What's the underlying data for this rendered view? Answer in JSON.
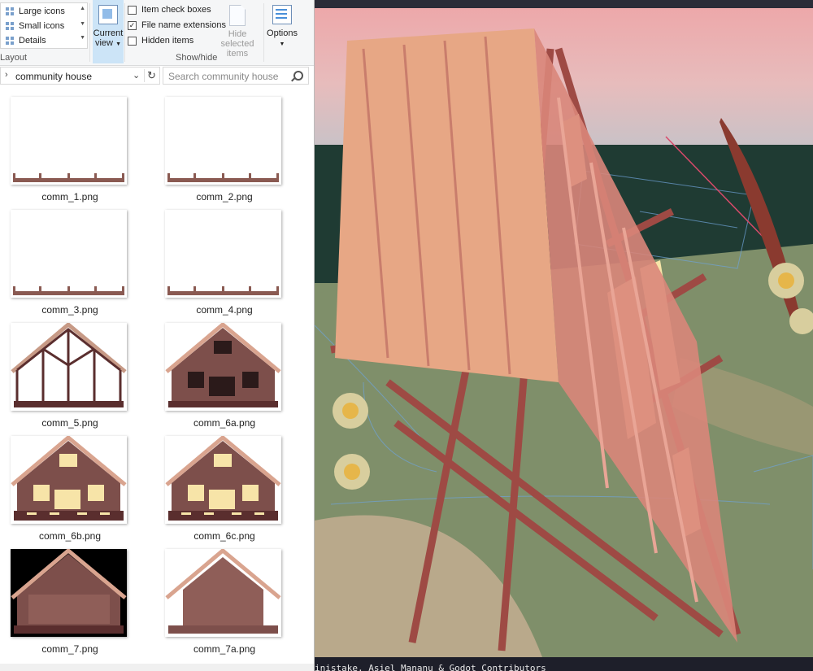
{
  "ribbon": {
    "layout_items": [
      "Large icons",
      "Small icons",
      "Details"
    ],
    "layout_group": "Layout",
    "current_view_line1": "Current",
    "current_view_line2": "view",
    "checkboxes": [
      {
        "label": "Item check boxes",
        "checked": false
      },
      {
        "label": "File name extensions",
        "checked": true
      },
      {
        "label": "Hidden items",
        "checked": false
      }
    ],
    "hide_selected_line1": "Hide selected",
    "hide_selected_line2": "items",
    "showhide_group": "Show/hide",
    "options_label": "Options"
  },
  "address": {
    "path": "community house",
    "search_placeholder": "Search community house"
  },
  "files": [
    {
      "name": "comm_1.png",
      "thumb": "fence"
    },
    {
      "name": "comm_2.png",
      "thumb": "fence"
    },
    {
      "name": "comm_3.png",
      "thumb": "fence"
    },
    {
      "name": "comm_4.png",
      "thumb": "fence"
    },
    {
      "name": "comm_5.png",
      "thumb": "frame"
    },
    {
      "name": "comm_6a.png",
      "thumb": "house-dark"
    },
    {
      "name": "comm_6b.png",
      "thumb": "house-lit"
    },
    {
      "name": "comm_6c.png",
      "thumb": "house-lit"
    },
    {
      "name": "comm_7.png",
      "thumb": "house-black"
    },
    {
      "name": "comm_7a.png",
      "thumb": "house-solid"
    }
  ],
  "viewport": {
    "status_text": "inistake, Asiel Mananu & Godot Contributors"
  },
  "colors": {
    "roof": "#d9a48f",
    "wall": "#7d4f4b",
    "window_lit": "#f7e4a8",
    "ground": "#7f8f6a",
    "sky": "#eda8aa"
  }
}
